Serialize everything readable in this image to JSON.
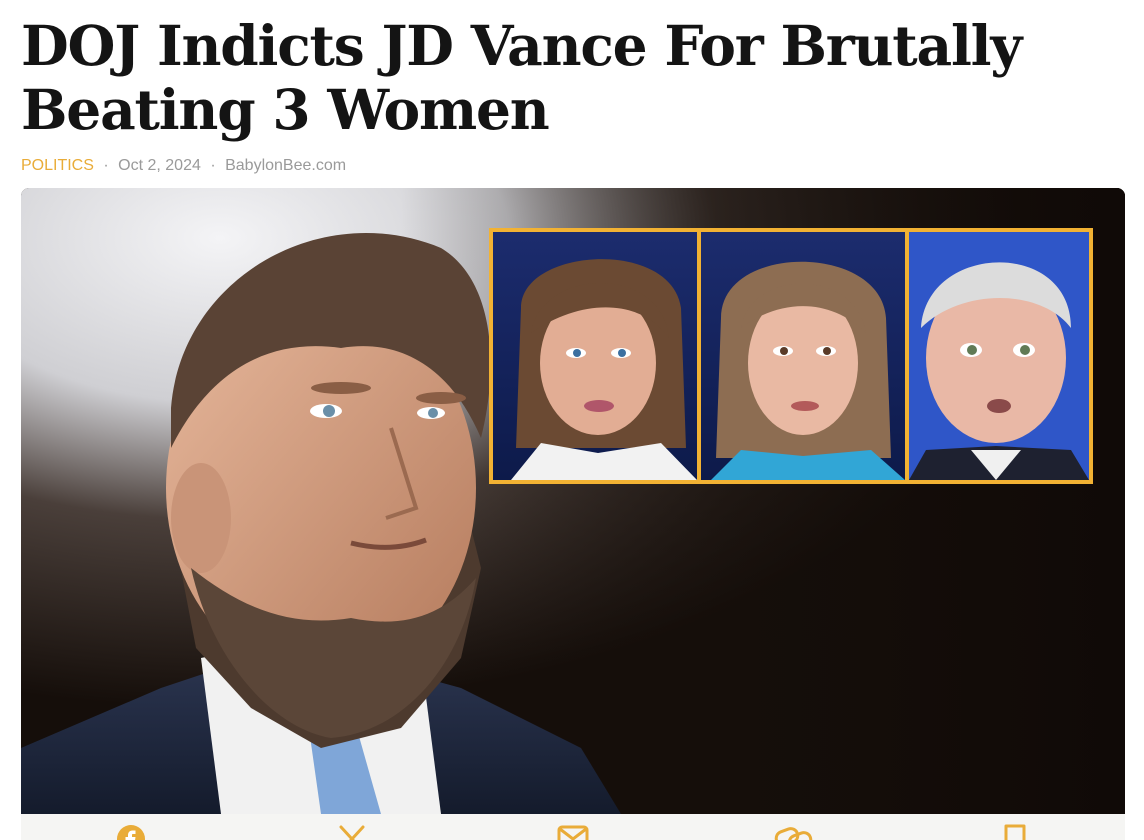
{
  "article": {
    "headline": "DOJ Indicts JD Vance For Brutally Beating 3 Women",
    "category": "POLITICS",
    "date": "Oct 2, 2024",
    "source": "BabylonBee.com",
    "separator": "·"
  },
  "hero_image": {
    "description_icon": "article-hero-photo",
    "inset_frame_color": "#f2b233",
    "inset_panels": [
      "news-anchor-woman-1",
      "news-anchor-woman-2",
      "man-in-dark-suit"
    ]
  },
  "share_bar": {
    "accent_color": "#e9ac38",
    "buttons": [
      {
        "icon": "facebook-icon"
      },
      {
        "icon": "x-icon"
      },
      {
        "icon": "email-icon"
      },
      {
        "icon": "link-icon"
      },
      {
        "icon": "bookmark-icon"
      }
    ]
  },
  "colors": {
    "category": "#e9ac38",
    "meta_text": "#9a9a9a",
    "headline": "#141414"
  }
}
